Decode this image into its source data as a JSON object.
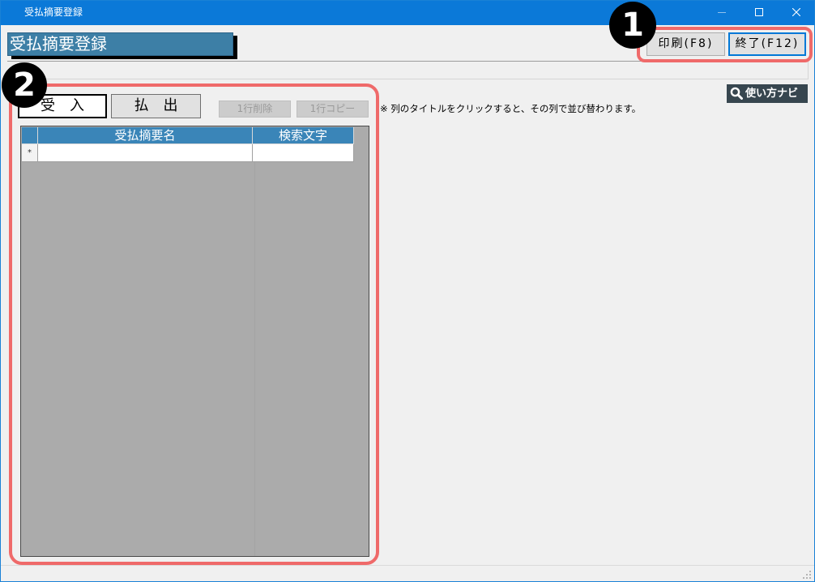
{
  "window": {
    "title": "受払摘要登録",
    "controls": [
      "minimize-icon",
      "maximize-icon",
      "close-icon"
    ]
  },
  "header": {
    "title": "受払摘要登録"
  },
  "toolbar": {
    "print_label": "印刷(F8)",
    "exit_label": "終了(F12)",
    "exit_focused": true
  },
  "annotations": {
    "marker_1": "1",
    "marker_2": "2"
  },
  "tabs": [
    {
      "label": "受　入",
      "selected": true
    },
    {
      "label": "払　出",
      "selected": false
    }
  ],
  "row_actions": {
    "delete_label": "1行削除",
    "copy_label": "1行コピー",
    "enabled": false
  },
  "hint": "※ 列のタイトルをクリックすると、その列で並び替わります。",
  "help_button": {
    "label": "使い方ナビ",
    "icon": "search-icon"
  },
  "grid": {
    "columns": [
      {
        "title": "受払摘要名"
      },
      {
        "title": "検索文字"
      }
    ],
    "rows": [],
    "new_row_marker": "*"
  },
  "colors": {
    "title_bar": "#0b79d8",
    "header_label": "#3d7fa6",
    "grid_header": "#3a85b8",
    "grid_background": "#ababab",
    "annotation_highlight": "#ef6a6a",
    "annotation_marker": "#000000",
    "help_button": "#37464f",
    "focus_border": "#0078d7"
  }
}
